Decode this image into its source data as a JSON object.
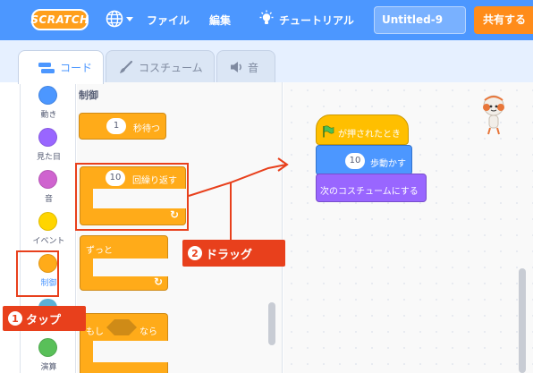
{
  "menubar": {
    "logo": "SCRATCH",
    "file_label": "ファイル",
    "edit_label": "編集",
    "tutorials_label": "チュートリアル",
    "project_title": "Untitled-9",
    "share_label": "共有する"
  },
  "tabs": [
    {
      "label": "コード"
    },
    {
      "label": "コスチューム"
    },
    {
      "label": "音"
    }
  ],
  "categories": [
    {
      "label": "動き",
      "color": "#4c97ff"
    },
    {
      "label": "見た目",
      "color": "#9966ff"
    },
    {
      "label": "音",
      "color": "#cf63cf"
    },
    {
      "label": "イベント",
      "color": "#ffd500"
    },
    {
      "label": "制御",
      "color": "#ffab19"
    },
    {
      "label": "演算",
      "color": "#59c059"
    }
  ],
  "palette": {
    "heading": "制御",
    "wait_value": "1",
    "wait_label": "秒待つ",
    "repeat_value": "10",
    "repeat_label": "回繰り返す",
    "forever_label": "ずっと",
    "if_label_left": "もし",
    "if_label_right": "なら"
  },
  "script": {
    "hat_label": "が押されたとき",
    "move_value": "10",
    "move_label": "歩動かす",
    "costume_label": "次のコスチュームにする"
  },
  "annotations": {
    "tap_num": "1",
    "tap_label": "タップ",
    "drag_num": "2",
    "drag_label": "ドラッグ"
  },
  "colors": {
    "menubar": "#4c97ff",
    "control": "#ffab19",
    "motion": "#4c97ff",
    "looks": "#9966ff",
    "event": "#ffbf00",
    "annotation": "#e8401c"
  }
}
